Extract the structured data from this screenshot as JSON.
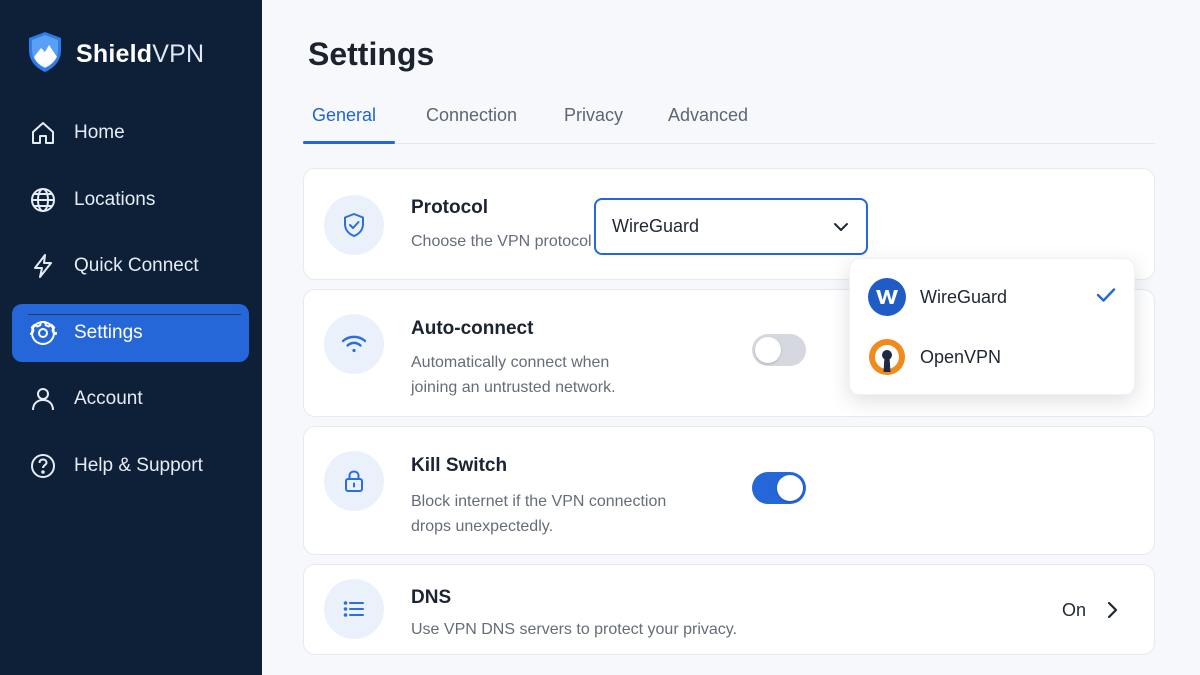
{
  "app": {
    "brand_bold": "Shield",
    "brand_light": "VPN"
  },
  "sidebar": {
    "items": [
      {
        "label": "Home",
        "icon": "home-icon"
      },
      {
        "label": "Locations",
        "icon": "globe-icon"
      },
      {
        "label": "Quick Connect",
        "icon": "lightning-icon"
      },
      {
        "label": "Settings",
        "icon": "gear-icon",
        "active": true
      },
      {
        "label": "Account",
        "icon": "user-icon"
      },
      {
        "label": "Help & Support",
        "icon": "help-icon"
      }
    ]
  },
  "page": {
    "title": "Settings",
    "tabs": [
      {
        "label": "General",
        "active": true
      },
      {
        "label": "Connection"
      },
      {
        "label": "Privacy"
      },
      {
        "label": "Advanced"
      }
    ]
  },
  "settings": {
    "protocol": {
      "title": "Protocol",
      "description": "Choose the VPN protocol that works best for you.",
      "selected": "WireGuard",
      "options": [
        {
          "label": "WireGuard",
          "selected": true
        },
        {
          "label": "OpenVPN",
          "selected": false
        }
      ]
    },
    "auto_connect": {
      "title": "Auto-connect",
      "description_line1": "Automatically connect when",
      "description_line2": "joining an untrusted network.",
      "enabled": false
    },
    "kill_switch": {
      "title": "Kill Switch",
      "description_line1": "Block internet if the VPN connection",
      "description_line2": "drops unexpectedly.",
      "enabled": true
    },
    "dns": {
      "title": "DNS",
      "description": "Use VPN DNS servers to protect your privacy.",
      "value": "On"
    }
  },
  "colors": {
    "sidebar_bg": "#0e1f38",
    "accent": "#2567d8",
    "page_bg": "#f6f8fb",
    "openvpn_orange": "#f08a1c"
  }
}
